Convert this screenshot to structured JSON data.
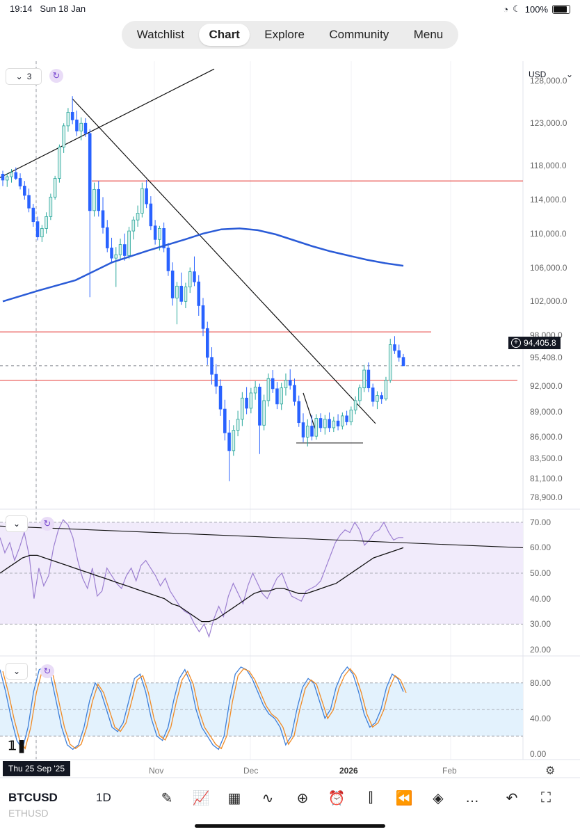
{
  "status": {
    "time": "19:14",
    "date": "Sun 18 Jan",
    "battery": "100%"
  },
  "nav": {
    "tabs": [
      "Watchlist",
      "Chart",
      "Explore",
      "Community",
      "Menu"
    ],
    "active": "Chart"
  },
  "main_pane": {
    "interval_count": "3",
    "currency": "USD",
    "price_axis": [
      "128,000.0",
      "123,000.0",
      "118,000.0",
      "114,000.0",
      "110,000.0",
      "106,000.0",
      "102,000.0",
      "98,000.0",
      "95,408.0",
      "92,000.0",
      "89,000.0",
      "86,000.0",
      "83,500.0",
      "81,100.0",
      "78,900.0"
    ],
    "current_price": "94,405.8"
  },
  "rsi_pane": {
    "axis": [
      "70.00",
      "60.00",
      "50.00",
      "40.00",
      "30.00",
      "20.00"
    ]
  },
  "stoch_pane": {
    "axis": [
      "80.00",
      "40.00",
      "0.00"
    ]
  },
  "time_axis": {
    "labels": [
      "Nov",
      "Dec",
      "2026",
      "Feb"
    ],
    "cursor_date": "Thu 25 Sep '25"
  },
  "toolbar": {
    "symbol": "BTCUSD",
    "symbol_next": "ETHUSD",
    "interval": "1D"
  },
  "colors": {
    "up": "#26a69a",
    "down": "#2962ff",
    "ma": "#2a5bd7",
    "hline": "#e53935",
    "rsi": "#9c7fd1",
    "stoch_k": "#3d7fd9",
    "stoch_d": "#f08a24"
  },
  "chart_data": {
    "type": "candlestick",
    "ylim": [
      77500,
      129500
    ],
    "candles": [
      [
        117000,
        117400,
        115600,
        116300
      ],
      [
        116300,
        117100,
        115500,
        116700
      ],
      [
        116700,
        117600,
        116000,
        117200
      ],
      [
        117200,
        117800,
        116300,
        116500
      ],
      [
        116500,
        117100,
        115200,
        115600
      ],
      [
        115600,
        116200,
        114000,
        114500
      ],
      [
        114500,
        115300,
        112500,
        113000
      ],
      [
        113000,
        113500,
        110800,
        111400
      ],
      [
        111400,
        112000,
        109200,
        109600
      ],
      [
        109600,
        111000,
        109000,
        110600
      ],
      [
        110600,
        112500,
        110000,
        112000
      ],
      [
        112000,
        114700,
        111600,
        114300
      ],
      [
        114300,
        116800,
        114000,
        116500
      ],
      [
        116500,
        120500,
        116000,
        120200
      ],
      [
        120200,
        123000,
        119500,
        122700
      ],
      [
        122700,
        124800,
        122000,
        124300
      ],
      [
        124300,
        126200,
        122900,
        123400
      ],
      [
        123400,
        124500,
        121500,
        122100
      ],
      [
        122100,
        123700,
        121000,
        123000
      ],
      [
        123000,
        123600,
        121400,
        121800
      ],
      [
        121800,
        122300,
        102500,
        112700
      ],
      [
        112700,
        116000,
        112000,
        115200
      ],
      [
        115200,
        116200,
        112000,
        112700
      ],
      [
        112700,
        114300,
        110000,
        110700
      ],
      [
        110700,
        111600,
        107800,
        108300
      ],
      [
        108300,
        109500,
        106600,
        107100
      ],
      [
        107100,
        108400,
        103700,
        107500
      ],
      [
        107500,
        109400,
        107000,
        108700
      ],
      [
        108700,
        110000,
        106800,
        107400
      ],
      [
        107400,
        110800,
        107000,
        110300
      ],
      [
        110300,
        112000,
        109300,
        111600
      ],
      [
        111600,
        113300,
        110800,
        112400
      ],
      [
        112400,
        116000,
        111900,
        115300
      ],
      [
        115300,
        116300,
        113000,
        113500
      ],
      [
        113500,
        114400,
        110400,
        110900
      ],
      [
        110900,
        111600,
        108700,
        109300
      ],
      [
        109300,
        110900,
        108000,
        110600
      ],
      [
        110600,
        111300,
        107800,
        108300
      ],
      [
        108300,
        108900,
        105000,
        105600
      ],
      [
        105600,
        106600,
        101500,
        102400
      ],
      [
        102400,
        104300,
        99300,
        103800
      ],
      [
        103800,
        105400,
        101600,
        102000
      ],
      [
        102000,
        104200,
        101200,
        103700
      ],
      [
        103700,
        106000,
        103000,
        105500
      ],
      [
        105500,
        107300,
        103800,
        104300
      ],
      [
        104300,
        105100,
        100300,
        101500
      ],
      [
        101500,
        102400,
        97900,
        98800
      ],
      [
        98800,
        99600,
        94500,
        95400
      ],
      [
        95400,
        96600,
        92200,
        93400
      ],
      [
        93400,
        94600,
        91100,
        92000
      ],
      [
        92000,
        92800,
        88500,
        89300
      ],
      [
        89300,
        90400,
        85600,
        86500
      ],
      [
        86500,
        88000,
        80800,
        84400
      ],
      [
        84400,
        87400,
        83800,
        86800
      ],
      [
        86800,
        89100,
        86100,
        88100
      ],
      [
        88100,
        91300,
        87300,
        90600
      ],
      [
        90600,
        91900,
        88700,
        89400
      ],
      [
        89400,
        91800,
        88800,
        91200
      ],
      [
        91200,
        92600,
        90400,
        91900
      ],
      [
        91900,
        92300,
        84000,
        87400
      ],
      [
        87400,
        91000,
        86800,
        90300
      ],
      [
        90300,
        93500,
        89600,
        92900
      ],
      [
        92900,
        93900,
        91200,
        91700
      ],
      [
        91700,
        92500,
        89300,
        89900
      ],
      [
        89900,
        92400,
        89200,
        91800
      ],
      [
        91800,
        93500,
        90900,
        92700
      ],
      [
        92700,
        94000,
        91600,
        92100
      ],
      [
        92100,
        92900,
        89700,
        90200
      ],
      [
        90200,
        90900,
        87200,
        87700
      ],
      [
        87700,
        88800,
        85400,
        86000
      ],
      [
        86000,
        88100,
        84900,
        87300
      ],
      [
        87300,
        88600,
        85600,
        86100
      ],
      [
        86100,
        88700,
        85700,
        88200
      ],
      [
        88200,
        88800,
        86600,
        87100
      ],
      [
        87100,
        88600,
        86300,
        88100
      ],
      [
        88100,
        88900,
        86600,
        87100
      ],
      [
        87100,
        88400,
        86600,
        87900
      ],
      [
        87900,
        88700,
        86800,
        87300
      ],
      [
        87300,
        88900,
        86900,
        88500
      ],
      [
        88500,
        89100,
        87400,
        87800
      ],
      [
        87800,
        89600,
        87400,
        89200
      ],
      [
        89200,
        90800,
        88700,
        90300
      ],
      [
        90300,
        92200,
        89800,
        91800
      ],
      [
        91800,
        94500,
        91300,
        93900
      ],
      [
        93900,
        94800,
        91300,
        91800
      ],
      [
        91800,
        92300,
        89600,
        90200
      ],
      [
        90200,
        91400,
        89300,
        90900
      ],
      [
        90900,
        91300,
        89900,
        90500
      ],
      [
        90500,
        93100,
        90300,
        92700
      ],
      [
        92700,
        97600,
        92400,
        96900
      ],
      [
        96900,
        97900,
        95800,
        96200
      ],
      [
        96200,
        96900,
        94900,
        95400
      ],
      [
        95400,
        95800,
        94600,
        94406
      ]
    ],
    "moving_average": [
      [
        0,
        102000
      ],
      [
        10,
        103300
      ],
      [
        20,
        104500
      ],
      [
        30,
        106600
      ],
      [
        40,
        108000
      ],
      [
        50,
        109300
      ],
      [
        55,
        110000
      ],
      [
        60,
        110500
      ],
      [
        65,
        110600
      ],
      [
        70,
        110400
      ],
      [
        75,
        109900
      ],
      [
        80,
        109200
      ],
      [
        85,
        108500
      ],
      [
        90,
        107900
      ],
      [
        95,
        107400
      ],
      [
        100,
        106900
      ],
      [
        105,
        106500
      ],
      [
        110,
        106200
      ]
    ],
    "horizontal_levels": [
      116200,
      98400,
      92700,
      85300
    ],
    "current_price": 94405.8,
    "rsi": {
      "ylim": [
        17.5,
        73.5
      ],
      "band": [
        30,
        70
      ],
      "values": [
        64,
        58,
        62,
        55,
        60,
        66,
        57,
        40,
        52,
        45,
        49,
        60,
        67,
        71,
        69,
        64,
        55,
        48,
        44,
        52,
        41,
        43,
        52,
        49,
        46,
        44,
        49,
        52,
        47,
        53,
        55,
        52,
        49,
        45,
        48,
        43,
        40,
        37,
        35,
        34,
        30,
        27,
        30,
        25,
        32,
        37,
        33,
        41,
        46,
        42,
        38,
        45,
        50,
        46,
        42,
        40,
        44,
        48,
        50,
        45,
        41,
        40,
        39,
        43,
        44,
        45,
        47,
        52,
        57,
        62,
        65,
        67,
        66,
        70,
        67,
        61,
        63,
        66,
        67,
        70,
        66,
        63,
        64,
        64
      ],
      "signal": [
        50,
        52,
        54,
        56,
        57,
        57,
        56,
        55,
        54,
        53,
        52,
        51,
        50,
        49,
        48,
        47,
        46,
        45,
        44,
        43,
        42,
        41,
        40,
        38,
        37,
        35,
        33,
        31,
        31,
        32,
        34,
        36,
        38,
        40,
        42,
        43,
        43,
        44,
        44,
        43,
        42,
        42,
        43,
        44,
        45,
        46,
        48,
        50,
        52,
        54,
        56,
        57,
        58,
        59,
        60
      ]
    },
    "stoch": {
      "ylim": [
        -5,
        105
      ],
      "band": [
        20,
        80
      ],
      "k": [
        95,
        70,
        40,
        15,
        5,
        30,
        70,
        95,
        98,
        90,
        60,
        30,
        10,
        5,
        10,
        30,
        60,
        80,
        70,
        50,
        30,
        25,
        35,
        60,
        85,
        90,
        70,
        40,
        20,
        15,
        30,
        60,
        85,
        95,
        80,
        50,
        30,
        20,
        10,
        5,
        20,
        60,
        90,
        98,
        95,
        85,
        70,
        55,
        45,
        40,
        30,
        10,
        20,
        50,
        75,
        85,
        80,
        60,
        40,
        50,
        75,
        90,
        98,
        90,
        70,
        45,
        30,
        35,
        50,
        75,
        90,
        85,
        70
      ]
    }
  }
}
